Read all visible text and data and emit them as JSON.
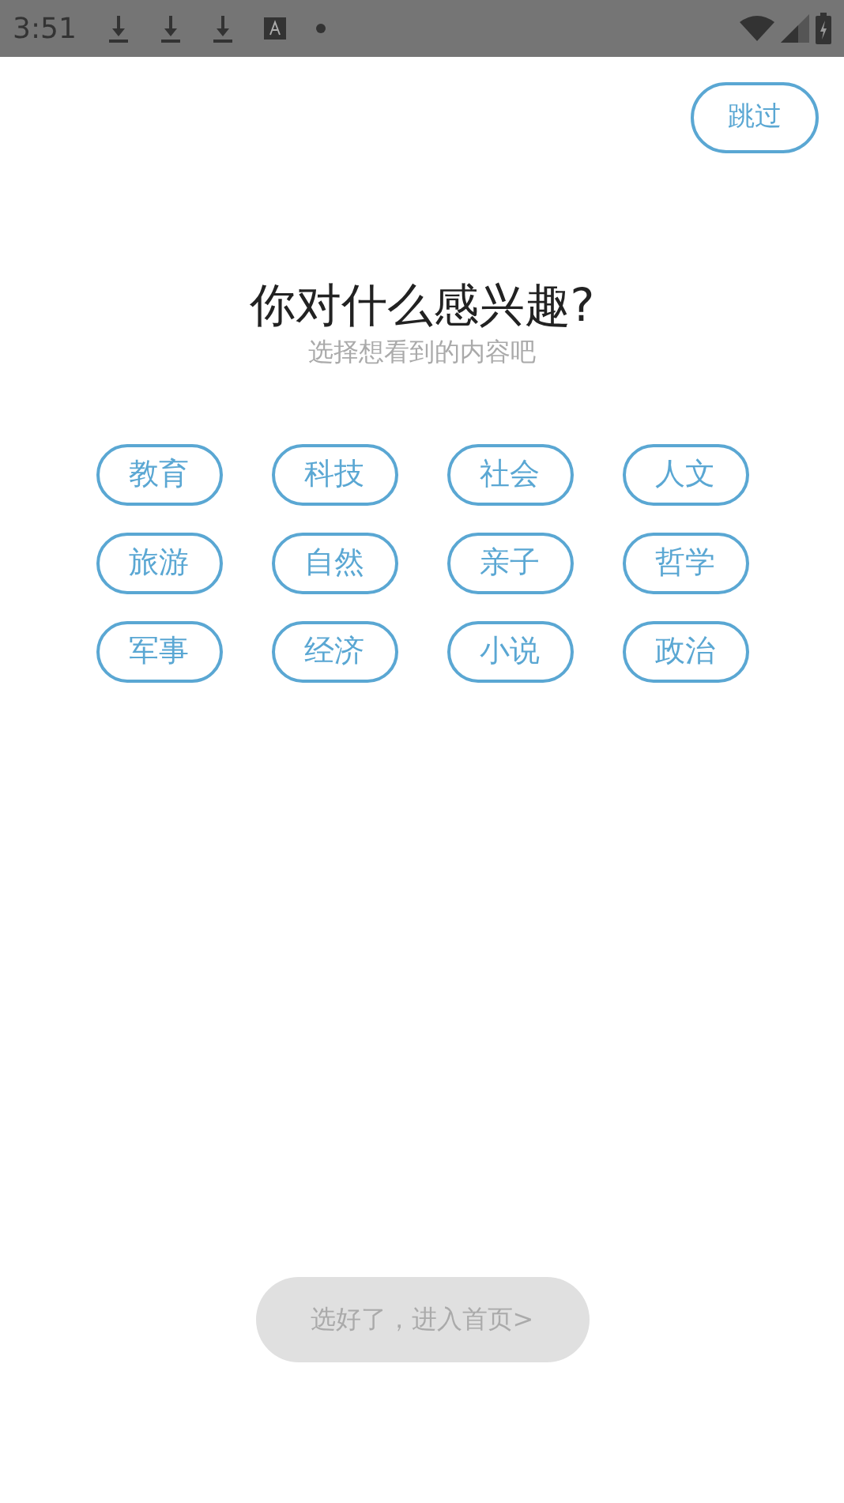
{
  "status_bar": {
    "time": "3:51"
  },
  "skip_button": {
    "label": "跳过"
  },
  "title": "你对什么感兴趣?",
  "subtitle": "选择想看到的内容吧",
  "topics": [
    {
      "label": "教育",
      "selected": false
    },
    {
      "label": "科技",
      "selected": false
    },
    {
      "label": "社会",
      "selected": false
    },
    {
      "label": "人文",
      "selected": false
    },
    {
      "label": "旅游",
      "selected": false
    },
    {
      "label": "自然",
      "selected": false
    },
    {
      "label": "亲子",
      "selected": false
    },
    {
      "label": "哲学",
      "selected": false
    },
    {
      "label": "军事",
      "selected": false
    },
    {
      "label": "经济",
      "selected": false
    },
    {
      "label": "小说",
      "selected": false
    },
    {
      "label": "政治",
      "selected": false
    }
  ],
  "continue_button": {
    "label": "选好了，进入首页>",
    "disabled": true
  }
}
